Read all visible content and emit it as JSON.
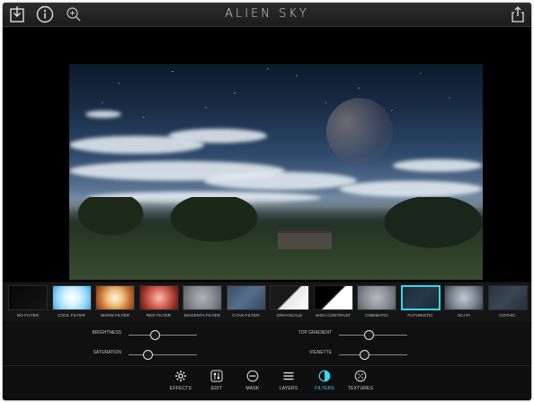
{
  "app": {
    "title": "ALIEN SKY"
  },
  "topbar": {
    "left_icons": [
      "import-icon",
      "info-icon",
      "zoom-icon"
    ],
    "right_icons": [
      "share-icon"
    ]
  },
  "filters": [
    {
      "label": "NO FILTER",
      "swatch": "linear-gradient(135deg,#060606,#151515)"
    },
    {
      "label": "COOL FILTER",
      "swatch": "radial-gradient(circle at 50% 50%, #ffffff 0%, #d8f2ff 35%, #8cd4ff 70%, #4a9fd0 100%)"
    },
    {
      "label": "WARM FILTER",
      "swatch": "radial-gradient(circle at 50% 50%, #fff5e6 0%, #f0c080 35%, #c06a30 70%, #7a3a1a 100%)"
    },
    {
      "label": "RED FILTER",
      "swatch": "radial-gradient(circle at 50% 50%, #f6c0b0 0%, #d06050 45%, #8a2a22 80%, #5a1812 100%)"
    },
    {
      "label": "MAGENTA FILTER",
      "swatch": "radial-gradient(circle at 50% 50%, #b0b4b8 0%, #8a8e92 50%, #5a5e62 100%)"
    },
    {
      "label": "CYAN FILTER",
      "swatch": "linear-gradient(135deg,#3a4e66,#566e8a 50%,#34465c)"
    },
    {
      "label": "GRAYSCALE",
      "swatch": "linear-gradient(135deg,#1a1a1a 0%,#1a1a1a 48%,#e8e8e8 52%,#ffffff 100%)"
    },
    {
      "label": "HIGH CONTRAST",
      "swatch": "linear-gradient(135deg,#000000 0%,#000000 48%,#ffffff 52%,#ffffff 100%)"
    },
    {
      "label": "CINEMATIC",
      "swatch": "radial-gradient(circle at 50% 50%, #b8bcc0 0%, #8a8e94 55%, #5c6066 100%)"
    },
    {
      "label": "FUTURISTIC",
      "swatch": "linear-gradient(135deg,#1a2a36,#263a48 50%,#1a2a36)"
    },
    {
      "label": "SCI-FI",
      "swatch": "radial-gradient(circle at 50% 50%, #c4cad2 0%, #7e8894 55%, #3e4650 100%)"
    },
    {
      "label": "GOTHIC",
      "swatch": "linear-gradient(135deg,#2a3440,#3a4654 50%,#26303a)"
    }
  ],
  "selected_filter": "FUTURISTIC",
  "accent_color": "#36d6f0",
  "sliders": [
    {
      "label": "BRIGHTNESS",
      "value": 0.38
    },
    {
      "label": "SATURATION",
      "value": 0.28
    },
    {
      "label": "TOP GRADIENT",
      "value": 0.44
    },
    {
      "label": "VIGNETTE",
      "value": 0.37
    }
  ],
  "toolbar": [
    {
      "label": "EFFECTS",
      "icon": "gear-icon"
    },
    {
      "label": "EDIT",
      "icon": "sliders-icon"
    },
    {
      "label": "MASK",
      "icon": "mask-icon"
    },
    {
      "label": "LAYERS",
      "icon": "layers-icon"
    },
    {
      "label": "FILTERS",
      "icon": "filters-icon",
      "active": true
    },
    {
      "label": "TEXTURES",
      "icon": "textures-icon"
    }
  ]
}
